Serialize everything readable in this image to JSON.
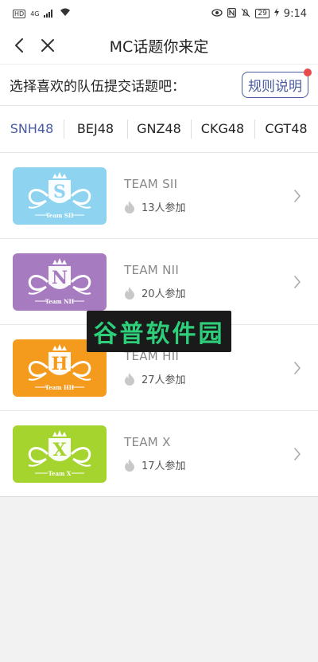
{
  "status_bar": {
    "left_badge": "HD",
    "network": "4G",
    "battery": "29",
    "time": "9:14"
  },
  "nav": {
    "title": "MC话题你来定",
    "back_icon": "chevron-left-icon",
    "close_icon": "close-icon"
  },
  "prompt": {
    "text": "选择喜欢的队伍提交话题吧：",
    "rules_label": "规则说明",
    "rules_accent": "#4a5ba0",
    "dot_color": "#e94b4b"
  },
  "tabs": [
    {
      "label": "SNH48",
      "active": true
    },
    {
      "label": "BEJ48",
      "active": false
    },
    {
      "label": "GNZ48",
      "active": false
    },
    {
      "label": "CKG48",
      "active": false
    },
    {
      "label": "CGT48",
      "active": false
    }
  ],
  "teams": [
    {
      "name": "TEAM SII",
      "count": "13人参加",
      "logo_letter": "S",
      "logo_sub": "Ⅱ",
      "logo_caption": "Team SII",
      "color": "#8ed3ef"
    },
    {
      "name": "TEAM NII",
      "count": "20人参加",
      "logo_letter": "N",
      "logo_sub": "Ⅱ",
      "logo_caption": "Team NII",
      "color": "#a77bc0"
    },
    {
      "name": "TEAM HII",
      "count": "27人参加",
      "logo_letter": "H",
      "logo_sub": "Ⅱ",
      "logo_caption": "Team HII",
      "color": "#f49a1c"
    },
    {
      "name": "TEAM X",
      "count": "17人参加",
      "logo_letter": "X",
      "logo_sub": "",
      "logo_caption": "Team X",
      "color": "#a4d42d"
    }
  ],
  "watermark": {
    "text": "谷普软件园",
    "color": "#2ecf7a"
  }
}
